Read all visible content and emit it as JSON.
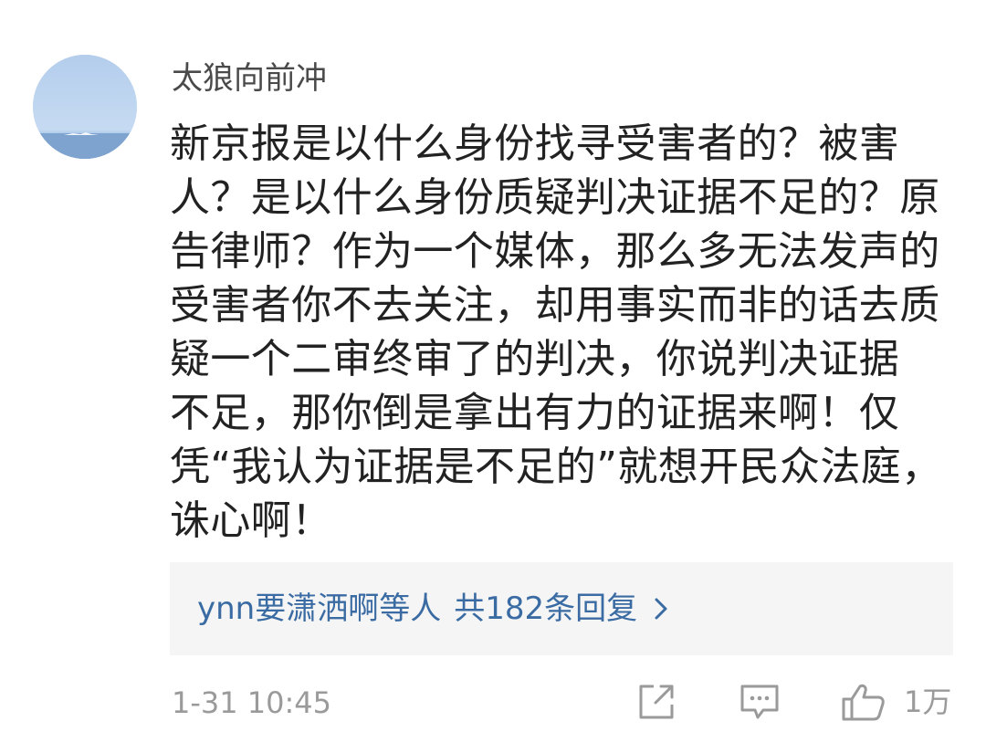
{
  "comment": {
    "username": "太狼向前冲",
    "body_lines": [
      "新京报是以什么身份找寻受害者的？被害",
      "人？是以什么身份质疑判决证据不足的？原",
      "告律师？作为一个媒体，那么多无法发声的",
      "受害者你不去关注，却用事实而非的话去质",
      "疑一个二审终审了的判决，你说判决证据",
      "不足，那你倒是拿出有力的证据来啊！仅",
      "凭“我认为证据是不足的”就想开民众法庭，",
      "诛心啊！"
    ],
    "replies": {
      "who": "ynn要潇洒啊",
      "etc": "等人",
      "count": "共182条回复"
    },
    "timestamp": "1-31 10:45",
    "likes": "1万"
  },
  "icons": {
    "avatar": "avatar-sea-photo",
    "share": "share-icon",
    "reply": "comment-icon",
    "like": "thumbs-up-icon",
    "chevron": "chevron-right-icon"
  },
  "colors": {
    "link": "#3a6ba3",
    "meta": "#9a9a9a",
    "text": "#222222",
    "panel": "#f5f5f5"
  }
}
